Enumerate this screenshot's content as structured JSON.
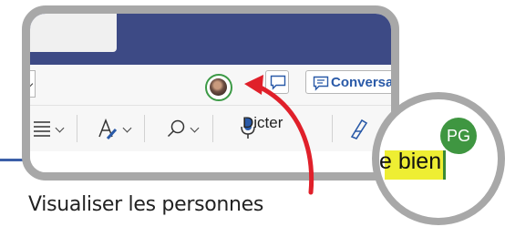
{
  "window": {
    "conversation_label": "Conversa",
    "dictate_label": "Dicter"
  },
  "caption": "Visualiser les personnes",
  "zoom": {
    "text": "e bien",
    "badge": "PG"
  },
  "colors": {
    "title_bar": "#3d4a85",
    "accent_blue": "#2a5aa8",
    "presence_green": "#3c9a46",
    "arrow_red": "#e0202a",
    "highlight_yellow": "#eeee33",
    "frame_gray": "#a8a8a8"
  },
  "icons": [
    "comment-icon",
    "conversation-icon",
    "list-icon",
    "text-style-icon",
    "search-icon",
    "microphone-icon",
    "editor-icon"
  ]
}
